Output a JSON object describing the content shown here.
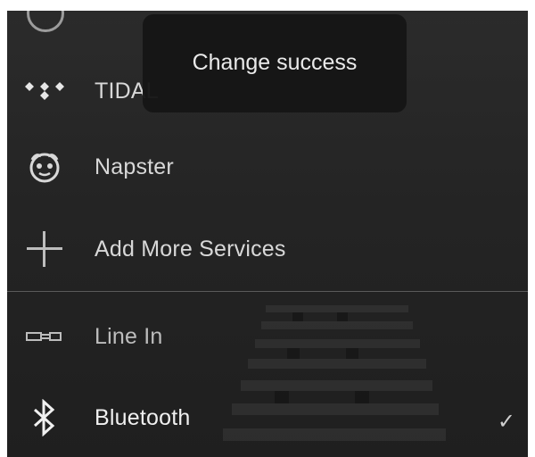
{
  "toast": {
    "message": "Change success"
  },
  "services": [
    {
      "label": "TIDAL",
      "icon": "tidal-icon"
    },
    {
      "label": "Napster",
      "icon": "napster-icon"
    },
    {
      "label": "Add More Services",
      "icon": "plus-icon"
    }
  ],
  "inputs": [
    {
      "label": "Line In",
      "icon": "line-in-icon"
    },
    {
      "label": "Bluetooth",
      "icon": "bluetooth-icon",
      "selected": true
    }
  ],
  "checkmark": "✓"
}
